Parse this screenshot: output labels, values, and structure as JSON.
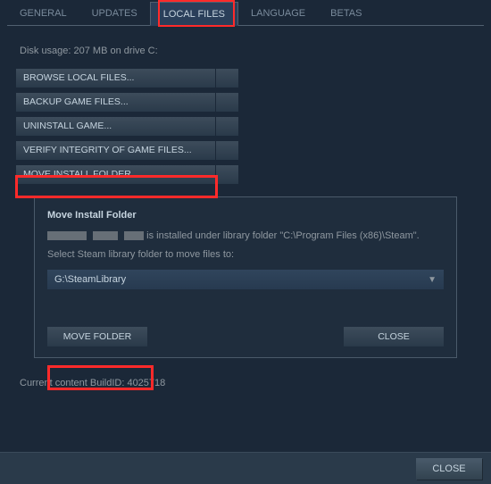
{
  "tabs": {
    "general": "GENERAL",
    "updates": "UPDATES",
    "local_files": "LOCAL FILES",
    "language": "LANGUAGE",
    "betas": "BETAS"
  },
  "disk_usage": "Disk usage: 207 MB on drive C:",
  "buttons": {
    "browse": "BROWSE LOCAL FILES...",
    "backup": "BACKUP GAME FILES...",
    "uninstall": "UNINSTALL GAME...",
    "verify": "VERIFY INTEGRITY OF GAME FILES...",
    "move_install": "MOVE INSTALL FOLDER..."
  },
  "panel": {
    "title": "Move Install Folder",
    "line1_suffix": " is installed under library folder \"C:\\Program Files (x86)\\Steam\".",
    "line2": "Select Steam library folder to move files to:",
    "selected_library": "G:\\SteamLibrary",
    "move_btn": "MOVE FOLDER",
    "close_btn": "CLOSE"
  },
  "build_id": "Current content BuildID: 4025718",
  "footer_close": "CLOSE"
}
